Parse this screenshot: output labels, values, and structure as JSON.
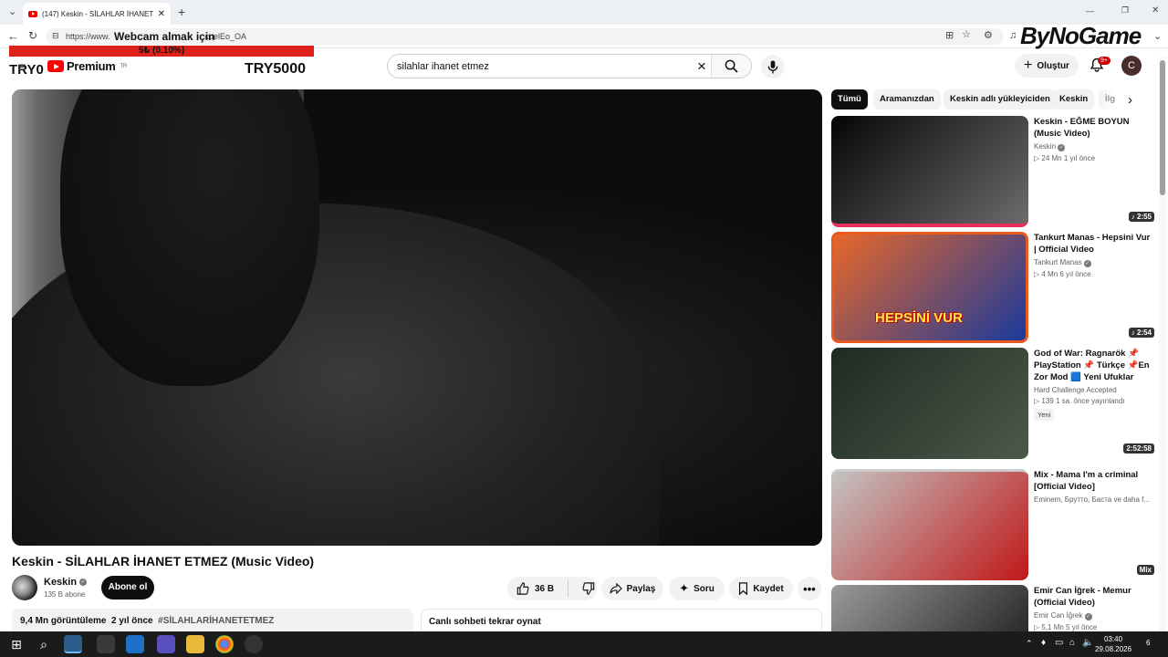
{
  "browser": {
    "tab_title": "(147) Keskin - SİLAHLAR İHANET E",
    "url": "https://www.",
    "url_tail": "cuelEo_OA",
    "new_tab": "+"
  },
  "overlay": {
    "webcam_text": "Webcam almak için",
    "progress_text": "5₺ (0.10%)",
    "left_amount": "TRY0",
    "right_amount": "TRY5000",
    "brand": "ByNoGame"
  },
  "header": {
    "logo_text": "Premium",
    "region": "TR",
    "search_query": "silahlar ihanet etmez",
    "create_label": "Oluştur",
    "notif_count": "9+",
    "avatar_letter": "C"
  },
  "video": {
    "title": "Keskin - SİLAHLAR İHANET ETMEZ (Music Video)",
    "channel": "Keskin",
    "subs": "135 B abone",
    "subscribe": "Abone ol",
    "likes": "36 B",
    "share": "Paylaş",
    "ask": "Soru",
    "save": "Kaydet",
    "views": "9,4 Mn görüntüleme",
    "age": "2 yıl önce",
    "hashtag": "#SİLAHLARİHANETETMEZ",
    "chat_replay": "Canlı sohbeti tekrar oynat"
  },
  "chips": [
    "Tümü",
    "Aramanızdan",
    "Keskin adlı yükleyiciden",
    "Keskin",
    "İlg"
  ],
  "related": [
    {
      "title": "Keskin - EĞME BOYUN (Music Video)",
      "channel": "Keskin",
      "meta": "▷ 24 Mn   1 yıl önce",
      "duration": "♪ 2:55",
      "colors": [
        "#050505",
        "#6b6b6b"
      ],
      "verified": true,
      "badge": ""
    },
    {
      "title": "Tankurt Manas - Hepsini Vur | Official Video",
      "channel": "Tankurt Manas",
      "meta": "▷ 4 Mn   6 yıl önce",
      "duration": "♪ 2:54",
      "colors": [
        "#e8672a",
        "#1a3a9a"
      ],
      "verified": true,
      "badge": "",
      "thumb_text": "HEPSİNİ VUR"
    },
    {
      "title": "God of War: Ragnarök 📌 PlayStation 📌 Türkçe 📌En Zor Mod 🟦 Yeni Ufuklar",
      "channel": "Hard Challenge Accepted",
      "meta": "▷ 139   1 sa. önce yayınlandı",
      "duration": "2:52:58",
      "colors": [
        "#1f2a22",
        "#4a5a4a"
      ],
      "verified": false,
      "badge": "Yeni"
    },
    {
      "title": "Mix - Mama I'm a criminal [Official Video]",
      "channel": "Eminem, Брутто, Баста ve daha f...",
      "meta": "",
      "duration": "Mix",
      "colors": [
        "#c4c4c4",
        "#c01818"
      ],
      "verified": false,
      "badge": ""
    },
    {
      "title": "Emir Can İğrek - Memur (Official Video)",
      "channel": "Emir Can İğrek",
      "meta": "▷ 5,1 Mn   5 yıl önce",
      "duration": "",
      "colors": [
        "#9a9a9a",
        "#2a2a2a"
      ],
      "verified": true,
      "badge": ""
    }
  ],
  "taskbar": {
    "time": "03:40",
    "date": "29.08.2026",
    "notif": "6"
  }
}
